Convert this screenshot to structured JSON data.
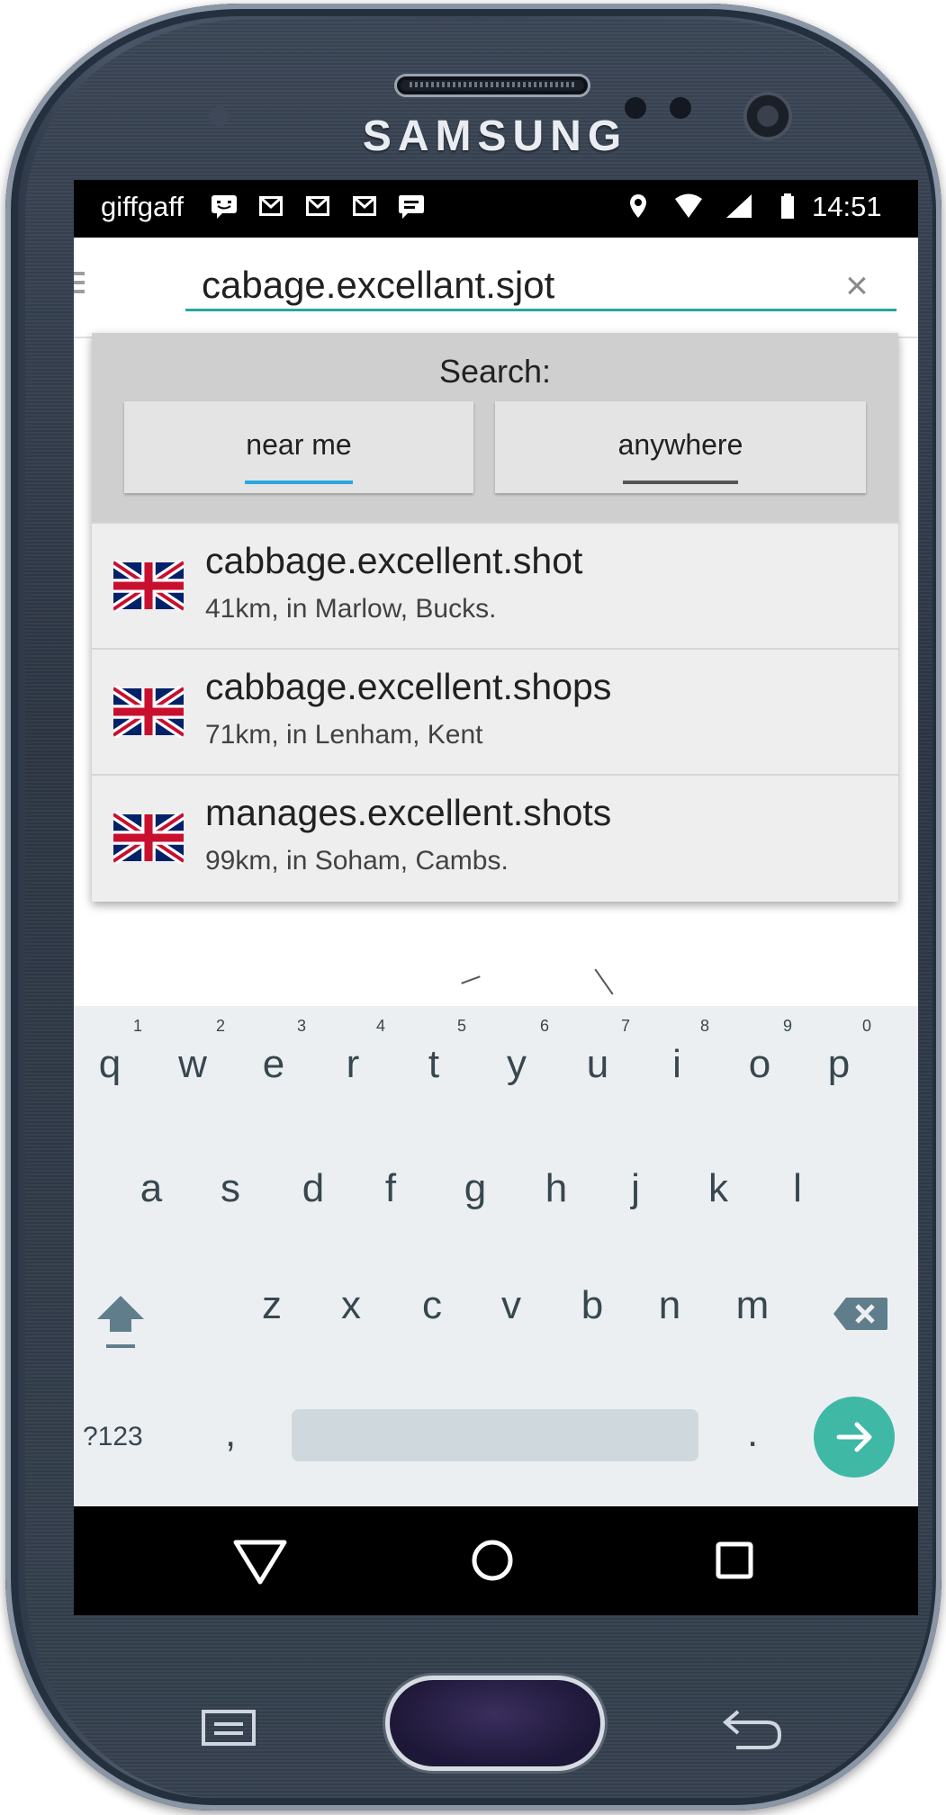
{
  "device": {
    "brand": "SAMSUNG"
  },
  "status_bar": {
    "carrier": "giffgaff",
    "time": "14:51",
    "left_icons": [
      "chat-icon",
      "gmail-icon",
      "gmail-icon",
      "gmail-icon",
      "message-icon"
    ],
    "right_icons": [
      "location-icon",
      "wifi-icon",
      "signal-icon",
      "battery-icon"
    ]
  },
  "search": {
    "value": "cabage.excellant.sjot",
    "clear_icon": "close-icon"
  },
  "dropdown": {
    "label": "Search:",
    "scopes": [
      {
        "label": "near me",
        "active": true
      },
      {
        "label": "anywhere",
        "active": false
      }
    ],
    "results": [
      {
        "words": "cabbage.excellent.shot",
        "detail": "41km, in Marlow, Bucks.",
        "flag": "uk-flag-icon"
      },
      {
        "words": "cabbage.excellent.shops",
        "detail": "71km, in Lenham, Kent",
        "flag": "uk-flag-icon"
      },
      {
        "words": "manages.excellent.shots",
        "detail": "99km, in Soham, Cambs.",
        "flag": "uk-flag-icon"
      }
    ]
  },
  "keyboard": {
    "row1": [
      {
        "key": "q",
        "hint": "1"
      },
      {
        "key": "w",
        "hint": "2"
      },
      {
        "key": "e",
        "hint": "3"
      },
      {
        "key": "r",
        "hint": "4"
      },
      {
        "key": "t",
        "hint": "5"
      },
      {
        "key": "y",
        "hint": "6"
      },
      {
        "key": "u",
        "hint": "7"
      },
      {
        "key": "i",
        "hint": "8"
      },
      {
        "key": "o",
        "hint": "9"
      },
      {
        "key": "p",
        "hint": "0"
      }
    ],
    "row2": [
      "a",
      "s",
      "d",
      "f",
      "g",
      "h",
      "j",
      "k",
      "l"
    ],
    "row3": [
      "z",
      "x",
      "c",
      "v",
      "b",
      "n",
      "m"
    ],
    "symbols": "?123",
    "comma": ",",
    "period": ".",
    "accent_color": "#3fb8a5"
  },
  "colors": {
    "search_underline": "#26a69a",
    "near_me_indicator": "#29a8e0"
  }
}
